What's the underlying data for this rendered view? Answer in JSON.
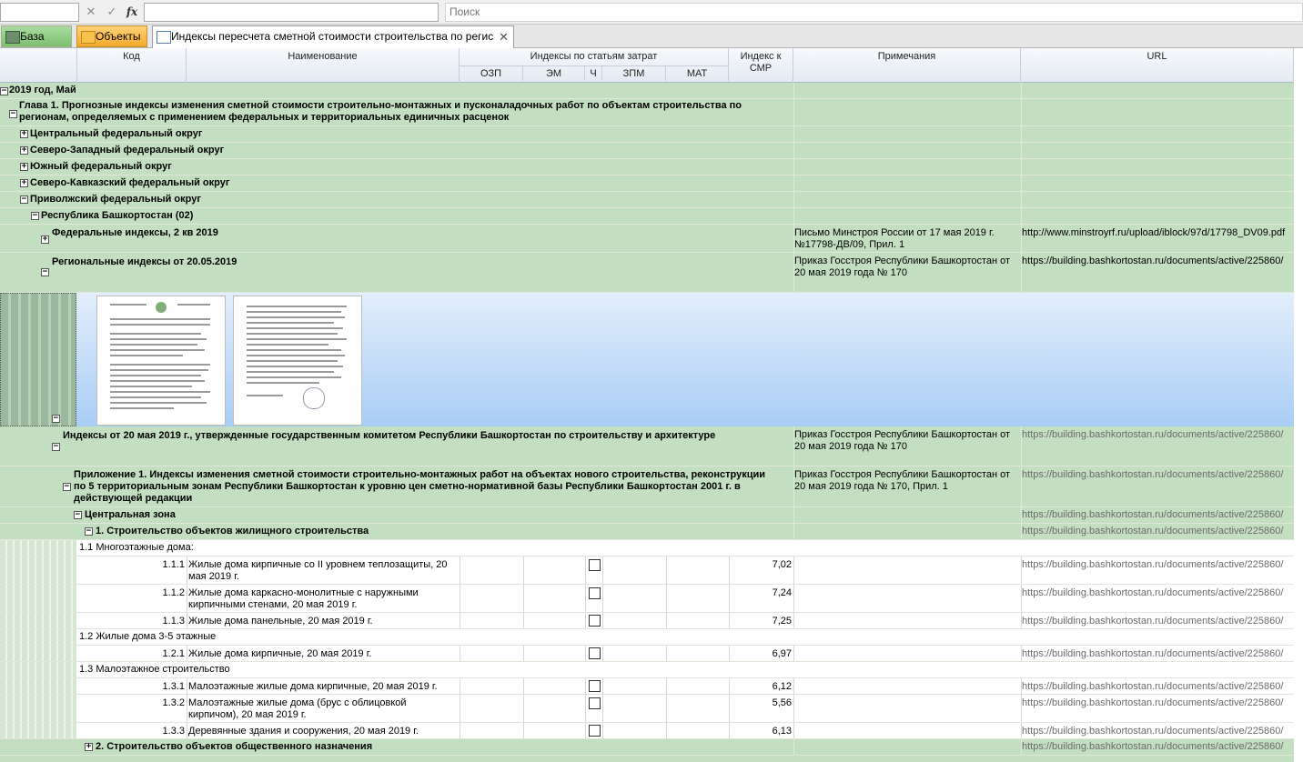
{
  "formula_bar": {
    "fx_label": "fx",
    "search_placeholder": "Поиск"
  },
  "tabs": [
    {
      "label": "База"
    },
    {
      "label": "Объекты"
    },
    {
      "label": "Индексы пересчета сметной стоимости строительства по регис"
    }
  ],
  "columns": {
    "code": "Код",
    "name": "Наименование",
    "indices_group": "Индексы по статьям затрат",
    "ozp": "ОЗП",
    "em": "ЭМ",
    "ch": "Ч",
    "zpm": "ЗПМ",
    "mat": "МАТ",
    "smr": "Индекс к СМР",
    "notes": "Примечания",
    "url": "URL"
  },
  "tree": {
    "year": "2019 год, Май",
    "chapter": "Глава 1. Прогнозные индексы изменения сметной стоимости строительно-монтажных и пусконаладочных работ по объектам строительства по регионам, определяемых с применением федеральных и территориальных единичных расценок",
    "districts": [
      "Центральный федеральный округ",
      "Северо-Западный федеральный округ",
      "Южный федеральный округ",
      "Северо-Кавказский федеральный округ",
      "Приволжский федеральный округ"
    ],
    "republic": "Республика Башкортостан (02)",
    "federal": {
      "label": "Федеральные индексы, 2 кв 2019",
      "note": "Письмо Минстроя России от 17 мая 2019 г. №17798-ДВ/09, Прил. 1",
      "url": "http://www.minstroyrf.ru/upload/iblock/97d/17798_DV09.pdf"
    },
    "regional": {
      "label": "Региональные индексы от 20.05.2019",
      "note": "Приказ Госстроя Республики Башкортостан от 20 мая 2019 года № 170",
      "url": "https://building.bashkortostan.ru/documents/active/225860/"
    },
    "indexes_20": {
      "label": "Индексы  от 20 мая 2019 г., утвержденные государственным комитетом Республики Башкортостан по строительству и архитектуре",
      "note": "Приказ Госстроя Республики Башкортостан от 20 мая 2019 года № 170",
      "url": "https://building.bashkortostan.ru/documents/active/225860/"
    },
    "appendix": {
      "label": "Приложение 1. Индексы изменения сметной стоимости строительно-монтажных работ на объектах нового строительства, реконструкции по 5 территориальным зонам  Республики Башкортостан к уровню цен  сметно-нормативной базы  Республики Башкортостан 2001 г. в действующей редакции",
      "note": "Приказ Госстроя Республики Башкортостан от 20 мая 2019 года № 170,  Прил. 1",
      "url": "https://building.bashkortostan.ru/documents/active/225860/"
    },
    "zone": {
      "label": "Центральная зона",
      "url": "https://building.bashkortostan.ru/documents/active/225860/"
    },
    "section1": {
      "label": "1. Строительство объектов жилищного строительства",
      "url": "https://building.bashkortostan.ru/documents/active/225860/"
    },
    "sub_headers": [
      "1.1 Многоэтажные дома:",
      "1.2 Жилые дома 3-5 этажные",
      "1.3 Малоэтажное строительство"
    ],
    "rows": [
      {
        "code": "1.1.1",
        "name": "Жилые дома кирпичные со II уровнем теплозащиты, 20 мая 2019 г.",
        "smr": "7,02",
        "url": "https://building.bashkortostan.ru/documents/active/225860/"
      },
      {
        "code": "1.1.2",
        "name": "Жилые дома каркасно-монолитные с наружными кирпичными стенами, 20 мая 2019 г.",
        "smr": "7,24",
        "url": "https://building.bashkortostan.ru/documents/active/225860/"
      },
      {
        "code": "1.1.3",
        "name": "Жилые дома панельные, 20 мая 2019 г.",
        "smr": "7,25",
        "url": "https://building.bashkortostan.ru/documents/active/225860/"
      },
      {
        "code": "1.2.1",
        "name": "Жилые дома кирпичные, 20 мая 2019 г.",
        "smr": "6,97",
        "url": "https://building.bashkortostan.ru/documents/active/225860/"
      },
      {
        "code": "1.3.1",
        "name": "Малоэтажные жилые дома кирпичные, 20 мая 2019 г.",
        "smr": "6,12",
        "url": "https://building.bashkortostan.ru/documents/active/225860/"
      },
      {
        "code": "1.3.2",
        "name": "Малоэтажные жилые дома (брус с облицовкой кирпичом), 20 мая 2019 г.",
        "smr": "5,56",
        "url": "https://building.bashkortostan.ru/documents/active/225860/"
      },
      {
        "code": "1.3.3",
        "name": "Деревянные здания и сооружения, 20 мая 2019 г.",
        "smr": "6,13",
        "url": "https://building.bashkortostan.ru/documents/active/225860/"
      }
    ],
    "section2": {
      "label": "2. Строительство объектов общественного назначения",
      "url": "https://building.bashkortostan.ru/documents/active/225860/"
    }
  }
}
